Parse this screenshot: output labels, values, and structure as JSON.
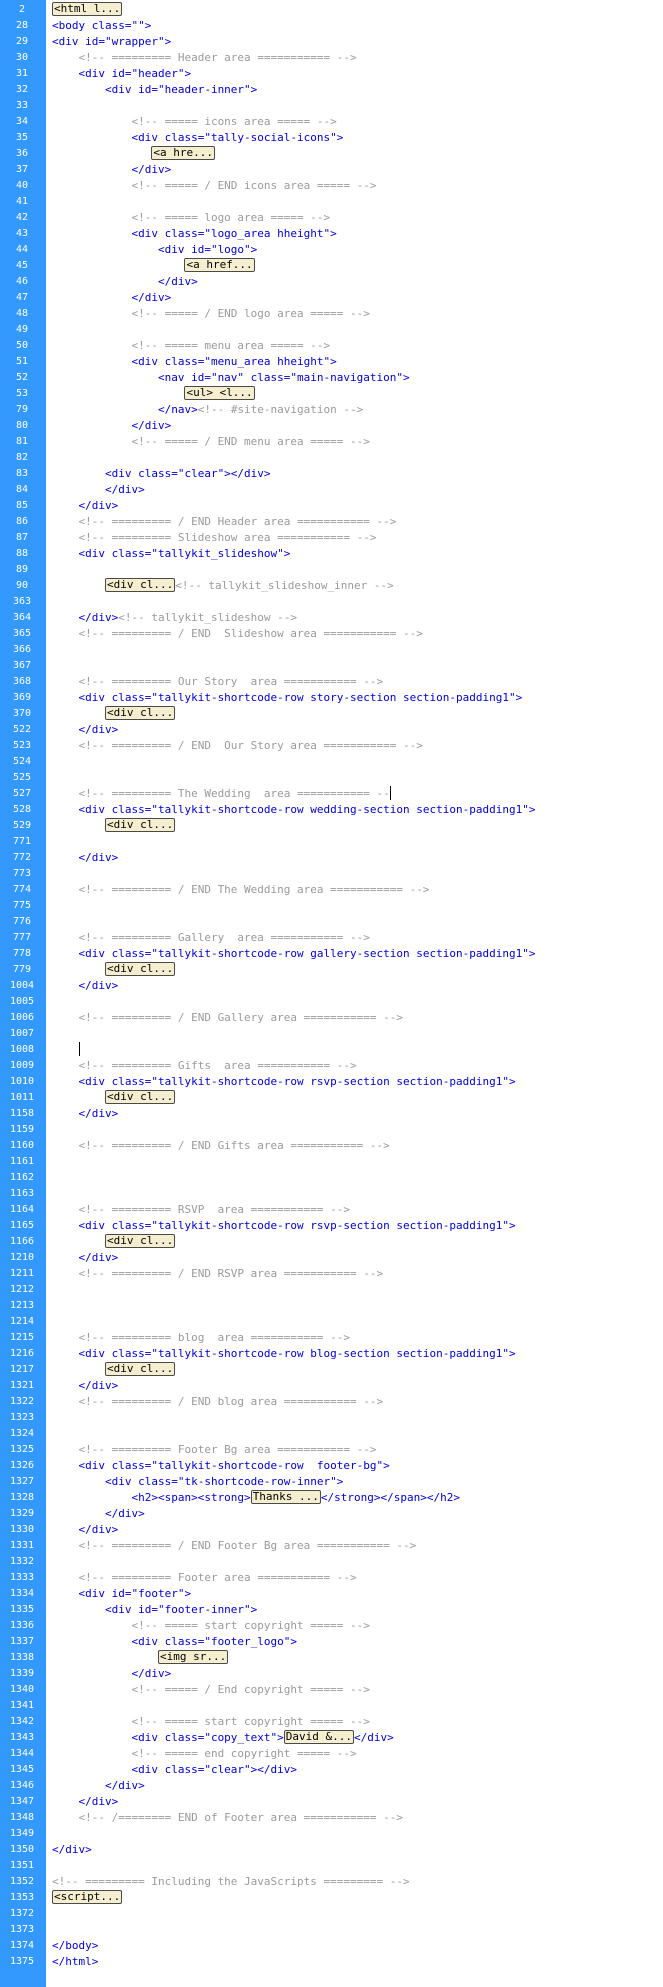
{
  "lines": [
    {
      "num": "2",
      "segs": [
        {
          "t": "f",
          "v": "<html l..."
        }
      ]
    },
    {
      "num": "28",
      "segs": [
        {
          "t": "k",
          "v": "<body class=\"\">"
        }
      ]
    },
    {
      "num": "29",
      "segs": [
        {
          "t": "k",
          "v": "<div id=\"wrapper\">"
        }
      ]
    },
    {
      "num": "30",
      "segs": [
        {
          "t": "c",
          "v": "    <!-- ========= Header area =========== -->"
        }
      ]
    },
    {
      "num": "31",
      "segs": [
        {
          "t": "k",
          "v": "    <div id=\"header\">"
        }
      ]
    },
    {
      "num": "32",
      "segs": [
        {
          "t": "k",
          "v": "        <div id=\"header-inner\">"
        }
      ]
    },
    {
      "num": "33",
      "segs": []
    },
    {
      "num": "34",
      "segs": [
        {
          "t": "c",
          "v": "            <!-- ===== icons area ===== -->"
        }
      ]
    },
    {
      "num": "35",
      "segs": [
        {
          "t": "k",
          "v": "            <div class=\"tally-social-icons\">"
        }
      ]
    },
    {
      "num": "36",
      "segs": [
        {
          "t": "p",
          "v": "               "
        },
        {
          "t": "f",
          "v": "<a hre..."
        }
      ]
    },
    {
      "num": "37",
      "segs": [
        {
          "t": "k",
          "v": "            </div>"
        }
      ]
    },
    {
      "num": "40",
      "segs": [
        {
          "t": "c",
          "v": "            <!-- ===== / END icons area ===== -->"
        }
      ]
    },
    {
      "num": "41",
      "segs": []
    },
    {
      "num": "42",
      "segs": [
        {
          "t": "c",
          "v": "            <!-- ===== logo area ===== -->"
        }
      ]
    },
    {
      "num": "43",
      "segs": [
        {
          "t": "k",
          "v": "            <div class=\"logo_area hheight\">"
        }
      ]
    },
    {
      "num": "44",
      "segs": [
        {
          "t": "k",
          "v": "                <div id=\"logo\">"
        }
      ]
    },
    {
      "num": "45",
      "segs": [
        {
          "t": "p",
          "v": "                    "
        },
        {
          "t": "f",
          "v": "<a href..."
        }
      ]
    },
    {
      "num": "46",
      "segs": [
        {
          "t": "k",
          "v": "                </div>"
        }
      ]
    },
    {
      "num": "47",
      "segs": [
        {
          "t": "k",
          "v": "            </div>"
        }
      ]
    },
    {
      "num": "48",
      "segs": [
        {
          "t": "c",
          "v": "            <!-- ===== / END logo area ===== -->"
        }
      ]
    },
    {
      "num": "49",
      "segs": []
    },
    {
      "num": "50",
      "segs": [
        {
          "t": "c",
          "v": "            <!-- ===== menu area ===== -->"
        }
      ]
    },
    {
      "num": "51",
      "segs": [
        {
          "t": "k",
          "v": "            <div class=\"menu_area hheight\">"
        }
      ]
    },
    {
      "num": "52",
      "segs": [
        {
          "t": "k",
          "v": "                <nav id=\"nav\" class=\"main-navigation\">"
        }
      ]
    },
    {
      "num": "53",
      "segs": [
        {
          "t": "p",
          "v": "                    "
        },
        {
          "t": "f",
          "v": "<ul> <l..."
        }
      ]
    },
    {
      "num": "79",
      "segs": [
        {
          "t": "k",
          "v": "                </nav>"
        },
        {
          "t": "c",
          "v": "<!-- #site-navigation -->"
        }
      ]
    },
    {
      "num": "80",
      "segs": [
        {
          "t": "k",
          "v": "            </div>"
        }
      ]
    },
    {
      "num": "81",
      "segs": [
        {
          "t": "c",
          "v": "            <!-- ===== / END menu area ===== -->"
        }
      ]
    },
    {
      "num": "82",
      "segs": []
    },
    {
      "num": "83",
      "segs": [
        {
          "t": "k",
          "v": "        <div class=\"clear\"></div>"
        }
      ]
    },
    {
      "num": "84",
      "segs": [
        {
          "t": "k",
          "v": "        </div>"
        }
      ]
    },
    {
      "num": "85",
      "segs": [
        {
          "t": "k",
          "v": "    </div>"
        }
      ]
    },
    {
      "num": "86",
      "segs": [
        {
          "t": "c",
          "v": "    <!-- ========= / END Header area =========== -->"
        }
      ]
    },
    {
      "num": "87",
      "segs": [
        {
          "t": "c",
          "v": "    <!-- ========= Slideshow area =========== -->"
        }
      ]
    },
    {
      "num": "88",
      "segs": [
        {
          "t": "k",
          "v": "    <div class=\"tallykit_slideshow\">"
        }
      ]
    },
    {
      "num": "89",
      "segs": []
    },
    {
      "num": "90",
      "segs": [
        {
          "t": "p",
          "v": "        "
        },
        {
          "t": "f",
          "v": "<div cl..."
        },
        {
          "t": "c",
          "v": "<!-- tallykit_slideshow_inner -->"
        }
      ]
    },
    {
      "num": "363",
      "segs": []
    },
    {
      "num": "364",
      "segs": [
        {
          "t": "k",
          "v": "    </div>"
        },
        {
          "t": "c",
          "v": "<!-- tallykit_slideshow -->"
        }
      ]
    },
    {
      "num": "365",
      "segs": [
        {
          "t": "c",
          "v": "    <!-- ========= / END  Slideshow area =========== -->"
        }
      ]
    },
    {
      "num": "366",
      "segs": []
    },
    {
      "num": "367",
      "segs": []
    },
    {
      "num": "368",
      "segs": [
        {
          "t": "c",
          "v": "    <!-- ========= Our Story  area =========== -->"
        }
      ]
    },
    {
      "num": "369",
      "segs": [
        {
          "t": "k",
          "v": "    <div class=\"tallykit-shortcode-row story-section section-padding1\">"
        }
      ]
    },
    {
      "num": "370",
      "segs": [
        {
          "t": "p",
          "v": "        "
        },
        {
          "t": "f",
          "v": "<div cl..."
        }
      ]
    },
    {
      "num": "522",
      "segs": [
        {
          "t": "k",
          "v": "    </div>"
        }
      ]
    },
    {
      "num": "523",
      "segs": [
        {
          "t": "c",
          "v": "    <!-- ========= / END  Our Story area =========== -->"
        }
      ]
    },
    {
      "num": "524",
      "segs": []
    },
    {
      "num": "525",
      "segs": []
    },
    {
      "num": "527",
      "segs": [
        {
          "t": "c",
          "v": "    <!-- ========= The Wedding  area =========== --"
        },
        {
          "t": "x"
        }
      ]
    },
    {
      "num": "528",
      "segs": [
        {
          "t": "k",
          "v": "    <div class=\"tallykit-shortcode-row wedding-section section-padding1\">"
        }
      ]
    },
    {
      "num": "529",
      "segs": [
        {
          "t": "p",
          "v": "        "
        },
        {
          "t": "f",
          "v": "<div cl..."
        }
      ]
    },
    {
      "num": "771",
      "segs": []
    },
    {
      "num": "772",
      "segs": [
        {
          "t": "k",
          "v": "    </div>"
        }
      ]
    },
    {
      "num": "773",
      "segs": []
    },
    {
      "num": "774",
      "segs": [
        {
          "t": "c",
          "v": "    <!-- ========= / END The Wedding area =========== -->"
        }
      ]
    },
    {
      "num": "775",
      "segs": []
    },
    {
      "num": "776",
      "segs": []
    },
    {
      "num": "777",
      "segs": [
        {
          "t": "c",
          "v": "    <!-- ========= Gallery  area =========== -->"
        }
      ]
    },
    {
      "num": "778",
      "segs": [
        {
          "t": "k",
          "v": "    <div class=\"tallykit-shortcode-row gallery-section section-padding1\">"
        }
      ]
    },
    {
      "num": "779",
      "segs": [
        {
          "t": "p",
          "v": "        "
        },
        {
          "t": "f",
          "v": "<div cl..."
        }
      ]
    },
    {
      "num": "1004",
      "segs": [
        {
          "t": "k",
          "v": "    </div>"
        }
      ]
    },
    {
      "num": "1005",
      "segs": []
    },
    {
      "num": "1006",
      "segs": [
        {
          "t": "c",
          "v": "    <!-- ========= / END Gallery area =========== -->"
        }
      ]
    },
    {
      "num": "1007",
      "segs": []
    },
    {
      "num": "1008",
      "segs": [
        {
          "t": "p",
          "v": "    "
        },
        {
          "t": "x"
        }
      ]
    },
    {
      "num": "1009",
      "segs": [
        {
          "t": "c",
          "v": "    <!-- ========= Gifts  area =========== -->"
        }
      ]
    },
    {
      "num": "1010",
      "segs": [
        {
          "t": "k",
          "v": "    <div class=\"tallykit-shortcode-row rsvp-section section-padding1\">"
        }
      ]
    },
    {
      "num": "1011",
      "segs": [
        {
          "t": "p",
          "v": "        "
        },
        {
          "t": "f",
          "v": "<div cl..."
        }
      ]
    },
    {
      "num": "1158",
      "segs": [
        {
          "t": "k",
          "v": "    </div>"
        }
      ]
    },
    {
      "num": "1159",
      "segs": []
    },
    {
      "num": "1160",
      "segs": [
        {
          "t": "c",
          "v": "    <!-- ========= / END Gifts area =========== -->"
        }
      ]
    },
    {
      "num": "1161",
      "segs": []
    },
    {
      "num": "1162",
      "segs": []
    },
    {
      "num": "1163",
      "segs": []
    },
    {
      "num": "1164",
      "segs": [
        {
          "t": "c",
          "v": "    <!-- ========= RSVP  area =========== -->"
        }
      ]
    },
    {
      "num": "1165",
      "segs": [
        {
          "t": "k",
          "v": "    <div class=\"tallykit-shortcode-row rsvp-section section-padding1\">"
        }
      ]
    },
    {
      "num": "1166",
      "segs": [
        {
          "t": "p",
          "v": "        "
        },
        {
          "t": "f",
          "v": "<div cl..."
        }
      ]
    },
    {
      "num": "1210",
      "segs": [
        {
          "t": "k",
          "v": "    </div>"
        }
      ]
    },
    {
      "num": "1211",
      "segs": [
        {
          "t": "c",
          "v": "    <!-- ========= / END RSVP area =========== -->"
        }
      ]
    },
    {
      "num": "1212",
      "segs": []
    },
    {
      "num": "1213",
      "segs": []
    },
    {
      "num": "1214",
      "segs": []
    },
    {
      "num": "1215",
      "segs": [
        {
          "t": "c",
          "v": "    <!-- ========= blog  area =========== -->"
        }
      ]
    },
    {
      "num": "1216",
      "segs": [
        {
          "t": "k",
          "v": "    <div class=\"tallykit-shortcode-row blog-section section-padding1\">"
        }
      ]
    },
    {
      "num": "1217",
      "segs": [
        {
          "t": "p",
          "v": "        "
        },
        {
          "t": "f",
          "v": "<div cl..."
        }
      ]
    },
    {
      "num": "1321",
      "segs": [
        {
          "t": "k",
          "v": "    </div>"
        }
      ]
    },
    {
      "num": "1322",
      "segs": [
        {
          "t": "c",
          "v": "    <!-- ========= / END blog area =========== -->"
        }
      ]
    },
    {
      "num": "1323",
      "segs": []
    },
    {
      "num": "1324",
      "segs": []
    },
    {
      "num": "1325",
      "segs": [
        {
          "t": "c",
          "v": "    <!-- ========= Footer Bg area =========== -->"
        }
      ]
    },
    {
      "num": "1326",
      "segs": [
        {
          "t": "k",
          "v": "    <div class=\"tallykit-shortcode-row  footer-bg\">"
        }
      ]
    },
    {
      "num": "1327",
      "segs": [
        {
          "t": "k",
          "v": "        <div class=\"tk-shortcode-row-inner\">"
        }
      ]
    },
    {
      "num": "1328",
      "segs": [
        {
          "t": "k",
          "v": "            <h2><span><strong>"
        },
        {
          "t": "f",
          "v": "Thanks ..."
        },
        {
          "t": "k",
          "v": "</strong></span></h2>"
        }
      ]
    },
    {
      "num": "1329",
      "segs": [
        {
          "t": "k",
          "v": "        </div>"
        }
      ]
    },
    {
      "num": "1330",
      "segs": [
        {
          "t": "k",
          "v": "    </div>"
        }
      ]
    },
    {
      "num": "1331",
      "segs": [
        {
          "t": "c",
          "v": "    <!-- ========= / END Footer Bg area =========== -->"
        }
      ]
    },
    {
      "num": "1332",
      "segs": []
    },
    {
      "num": "1333",
      "segs": [
        {
          "t": "c",
          "v": "    <!-- ========= Footer area =========== -->"
        }
      ]
    },
    {
      "num": "1334",
      "segs": [
        {
          "t": "k",
          "v": "    <div id=\"footer\">"
        }
      ]
    },
    {
      "num": "1335",
      "segs": [
        {
          "t": "k",
          "v": "        <div id=\"footer-inner\">"
        }
      ]
    },
    {
      "num": "1336",
      "segs": [
        {
          "t": "c",
          "v": "            <!-- ===== start copyright ===== -->"
        }
      ]
    },
    {
      "num": "1337",
      "segs": [
        {
          "t": "k",
          "v": "            <div class=\"footer_logo\">"
        }
      ]
    },
    {
      "num": "1338",
      "segs": [
        {
          "t": "p",
          "v": "                "
        },
        {
          "t": "f",
          "v": "<img sr..."
        }
      ]
    },
    {
      "num": "1339",
      "segs": [
        {
          "t": "k",
          "v": "            </div>"
        }
      ]
    },
    {
      "num": "1340",
      "segs": [
        {
          "t": "c",
          "v": "            <!-- ===== / End copyright ===== -->"
        }
      ]
    },
    {
      "num": "1341",
      "segs": []
    },
    {
      "num": "1342",
      "segs": [
        {
          "t": "c",
          "v": "            <!-- ===== start copyright ===== -->"
        }
      ]
    },
    {
      "num": "1343",
      "segs": [
        {
          "t": "k",
          "v": "            <div class=\"copy_text\">"
        },
        {
          "t": "f",
          "v": "David &..."
        },
        {
          "t": "k",
          "v": "</div>"
        }
      ]
    },
    {
      "num": "1344",
      "segs": [
        {
          "t": "c",
          "v": "            <!-- ===== end copyright ===== -->"
        }
      ]
    },
    {
      "num": "1345",
      "segs": [
        {
          "t": "k",
          "v": "            <div class=\"clear\"></div>"
        }
      ]
    },
    {
      "num": "1346",
      "segs": [
        {
          "t": "k",
          "v": "        </div>"
        }
      ]
    },
    {
      "num": "1347",
      "segs": [
        {
          "t": "k",
          "v": "    </div>"
        }
      ]
    },
    {
      "num": "1348",
      "segs": [
        {
          "t": "c",
          "v": "    <!-- /======== END of Footer area =========== -->"
        }
      ]
    },
    {
      "num": "1349",
      "segs": []
    },
    {
      "num": "1350",
      "segs": [
        {
          "t": "k",
          "v": "</div>"
        }
      ]
    },
    {
      "num": "1351",
      "segs": []
    },
    {
      "num": "1352",
      "segs": [
        {
          "t": "c",
          "v": "<!-- ========= Including the JavaScripts ========= -->"
        }
      ]
    },
    {
      "num": "1353",
      "segs": [
        {
          "t": "f",
          "v": "<script..."
        }
      ]
    },
    {
      "num": "1372",
      "segs": []
    },
    {
      "num": "1373",
      "segs": []
    },
    {
      "num": "1374",
      "segs": [
        {
          "t": "k",
          "v": "</body>"
        }
      ]
    },
    {
      "num": "1375",
      "segs": [
        {
          "t": "k",
          "v": "</html>"
        }
      ]
    }
  ]
}
